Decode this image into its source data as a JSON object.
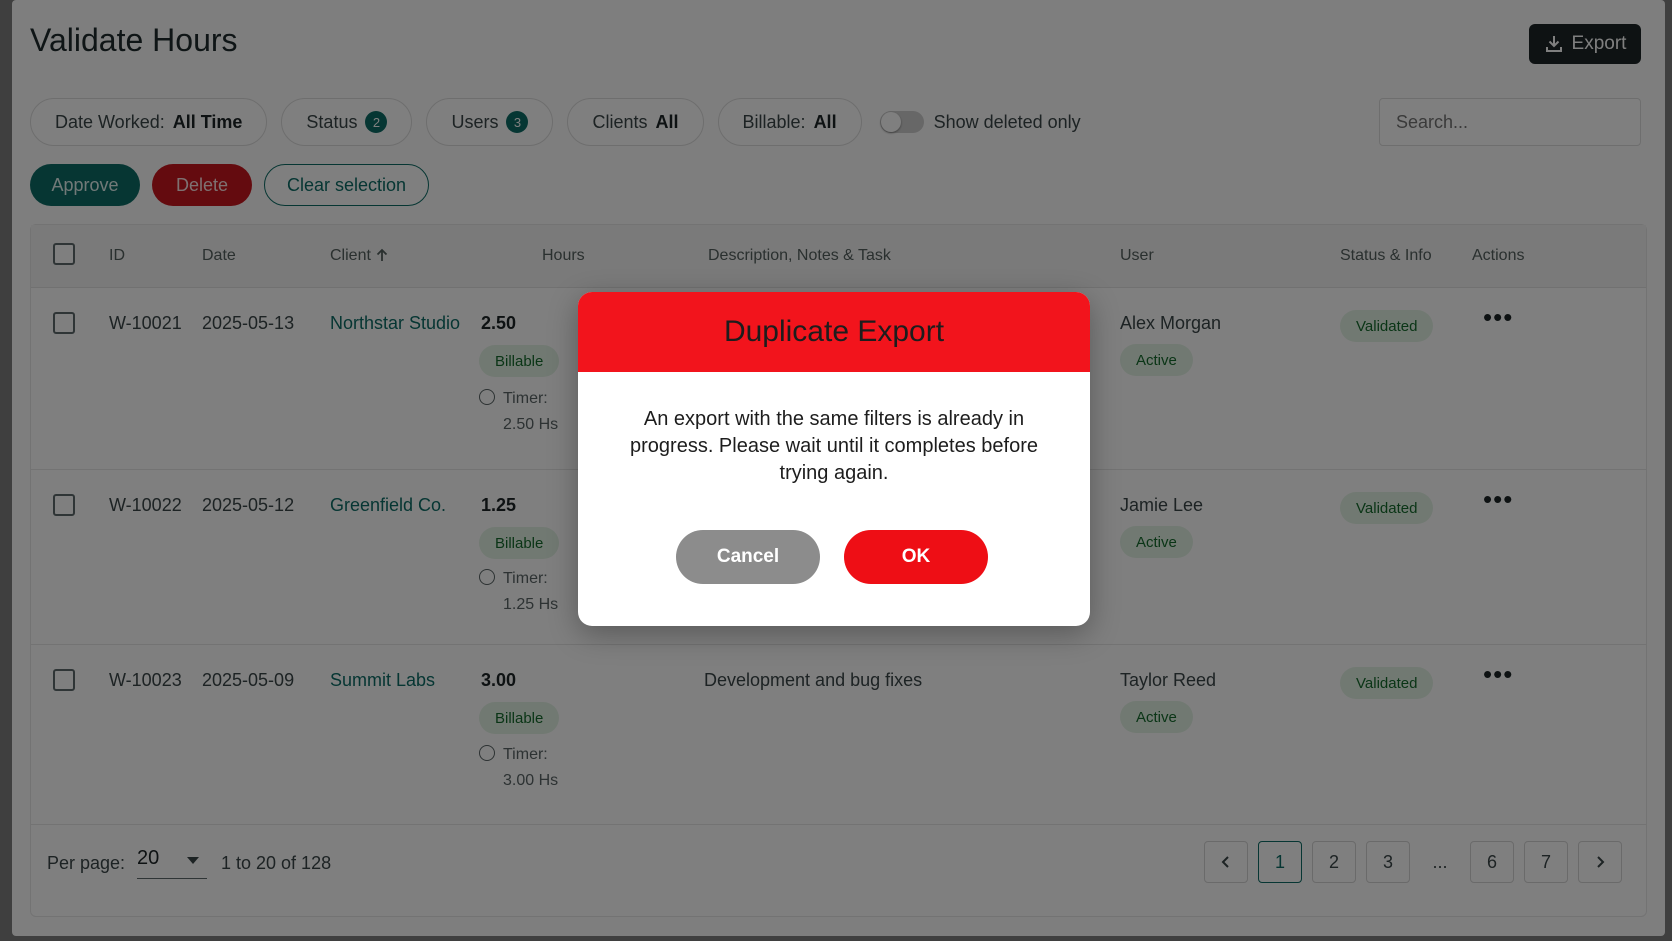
{
  "page": {
    "title": "Validate Hours",
    "export_label": "Export"
  },
  "filters": {
    "date_worked_label": "Date Worked:",
    "date_worked_value": "All Time",
    "status_label": "Status",
    "status_count": "2",
    "users_label": "Users",
    "users_count": "3",
    "clients_label": "Clients",
    "clients_value": "All",
    "billable_label": "Billable:",
    "billable_value": "All",
    "show_deleted_label": "Show deleted only",
    "search_placeholder": "Search..."
  },
  "bulk_actions": {
    "approve": "Approve",
    "delete": "Delete",
    "clear": "Clear selection"
  },
  "table": {
    "headers": {
      "id": "ID",
      "date": "Date",
      "client": "Client",
      "hours": "Hours",
      "description": "Description, Notes & Task",
      "user": "User",
      "status": "Status & Info",
      "actions": "Actions"
    },
    "sort_icon": "arrow-up-icon",
    "rows": [
      {
        "id": "W-10021",
        "date": "2025-05-13",
        "client": "Northstar Studio",
        "hours": "2.50",
        "billable": "Billable",
        "timer_label": "Timer:",
        "timer_value": "2.50 Hs",
        "description": "",
        "user": "Alex Morgan",
        "user_status": "Active",
        "status": "Validated"
      },
      {
        "id": "W-10022",
        "date": "2025-05-12",
        "client": "Greenfield Co.",
        "hours": "1.25",
        "billable": "Billable",
        "timer_label": "Timer:",
        "timer_value": "1.25 Hs",
        "description": "",
        "user": "Jamie Lee",
        "user_status": "Active",
        "status": "Validated"
      },
      {
        "id": "W-10023",
        "date": "2025-05-09",
        "client": "Summit Labs",
        "hours": "3.00",
        "billable": "Billable",
        "timer_label": "Timer:",
        "timer_value": "3.00 Hs",
        "description": "Development and bug fixes",
        "user": "Taylor Reed",
        "user_status": "Active",
        "status": "Validated"
      }
    ]
  },
  "footer": {
    "per_page_label": "Per page:",
    "per_page_value": "20",
    "range": "1 to 20 of 128",
    "pages": [
      "1",
      "2",
      "3",
      "...",
      "6",
      "7"
    ],
    "current_page": "1"
  },
  "modal": {
    "title": "Duplicate Export",
    "message": "An export with the same filters is already in progress. Please wait until it completes before trying again.",
    "cancel": "Cancel",
    "ok": "OK"
  },
  "colors": {
    "primary": "#0d6d66",
    "danger": "#c8161e",
    "modal_header": "#f2141c",
    "ok": "#ee0e15",
    "cancel": "#8c8c8c"
  }
}
